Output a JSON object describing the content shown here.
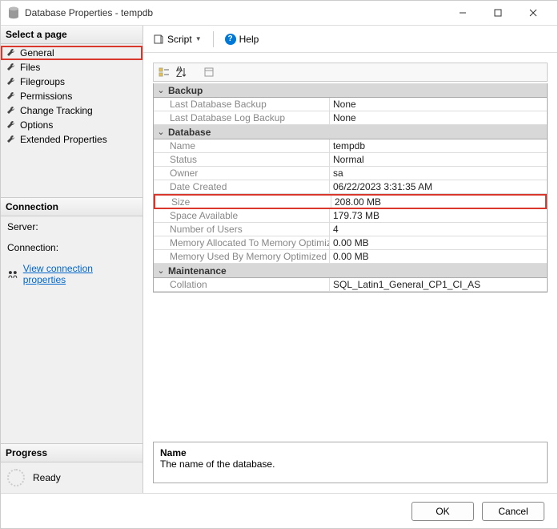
{
  "window": {
    "title": "Database Properties - tempdb"
  },
  "pages": {
    "header": "Select a page",
    "items": [
      {
        "label": "General",
        "selected": true
      },
      {
        "label": "Files"
      },
      {
        "label": "Filegroups"
      },
      {
        "label": "Permissions"
      },
      {
        "label": "Change Tracking"
      },
      {
        "label": "Options"
      },
      {
        "label": "Extended Properties"
      }
    ]
  },
  "connection": {
    "header": "Connection",
    "server_label": "Server:",
    "connection_label": "Connection:",
    "view_props": "View connection properties"
  },
  "progress": {
    "header": "Progress",
    "status": "Ready"
  },
  "toolbar": {
    "script": "Script",
    "help": "Help"
  },
  "grid": {
    "categories": [
      {
        "name": "Backup",
        "rows": [
          {
            "name": "Last Database Backup",
            "value": "None"
          },
          {
            "name": "Last Database Log Backup",
            "value": "None"
          }
        ]
      },
      {
        "name": "Database",
        "rows": [
          {
            "name": "Name",
            "value": "tempdb"
          },
          {
            "name": "Status",
            "value": "Normal"
          },
          {
            "name": "Owner",
            "value": "sa"
          },
          {
            "name": "Date Created",
            "value": "06/22/2023 3:31:35 AM"
          },
          {
            "name": "Size",
            "value": "208.00 MB",
            "highlight": true
          },
          {
            "name": "Space Available",
            "value": "179.73 MB"
          },
          {
            "name": "Number of Users",
            "value": "4"
          },
          {
            "name": "Memory Allocated To Memory Optimized Objects",
            "value": "0.00 MB"
          },
          {
            "name": "Memory Used By Memory Optimized Objects",
            "value": "0.00 MB"
          }
        ]
      },
      {
        "name": "Maintenance",
        "rows": [
          {
            "name": "Collation",
            "value": "SQL_Latin1_General_CP1_CI_AS"
          }
        ]
      }
    ]
  },
  "desc": {
    "title": "Name",
    "text": "The name of the database."
  },
  "footer": {
    "ok": "OK",
    "cancel": "Cancel"
  }
}
